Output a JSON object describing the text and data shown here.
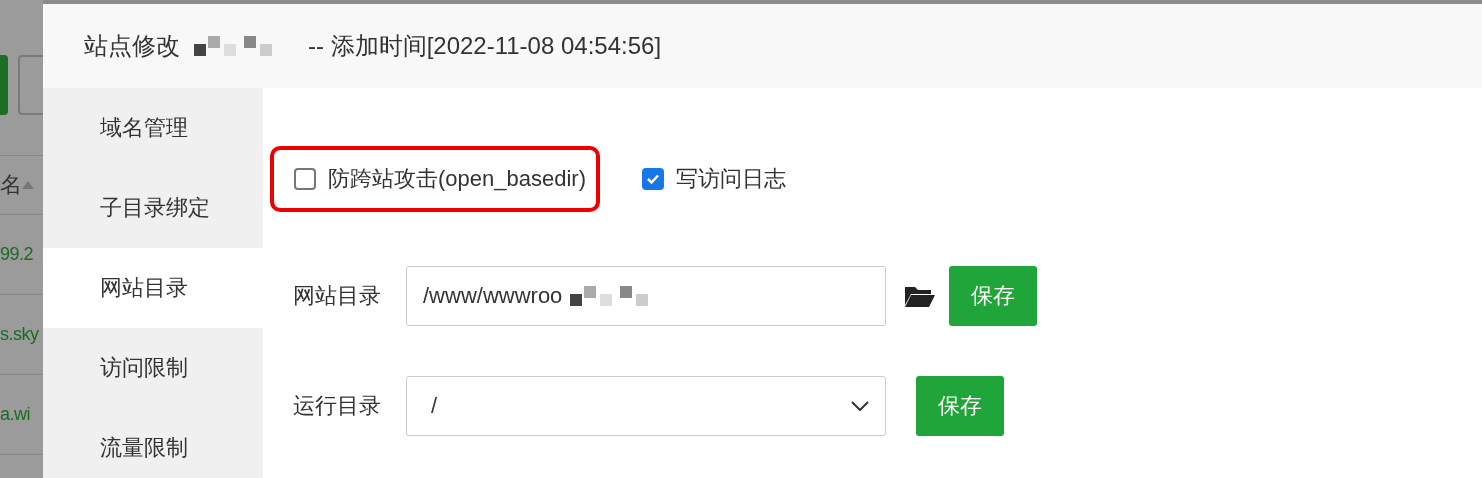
{
  "background_page": {
    "column_header": "名",
    "rows": [
      "99.2",
      "s.sky",
      "a.wi"
    ]
  },
  "dialog": {
    "title": "站点修改",
    "title_suffix": "-- 添加时间[2022-11-08 04:54:56]",
    "sidebar": [
      {
        "label": "域名管理",
        "selected": false
      },
      {
        "label": "子目录绑定",
        "selected": false
      },
      {
        "label": "网站目录",
        "selected": true
      },
      {
        "label": "访问限制",
        "selected": false
      },
      {
        "label": "流量限制",
        "selected": false
      }
    ],
    "options": [
      {
        "label": "防跨站攻击(open_basedir)",
        "checked": false,
        "highlighted": true
      },
      {
        "label": "写访问日志",
        "checked": true,
        "highlighted": false
      }
    ],
    "site_dir": {
      "label": "网站目录",
      "value": "/www/wwwroo",
      "button": "保存"
    },
    "run_dir": {
      "label": "运行目录",
      "value": "/",
      "button": "保存"
    }
  }
}
